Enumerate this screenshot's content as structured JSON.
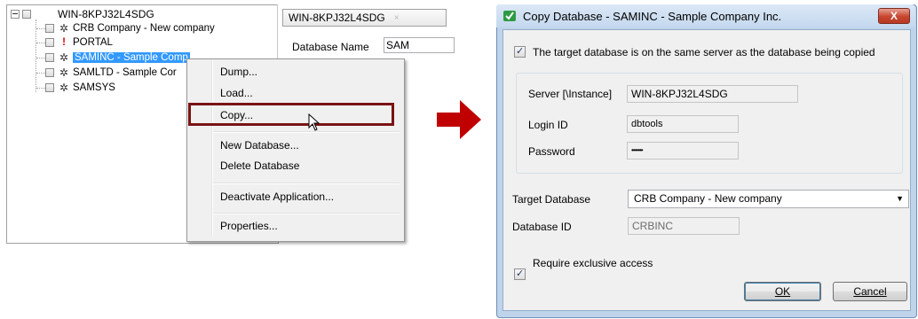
{
  "tree": {
    "root_label": "WIN-8KPJ32L4SDG",
    "items": [
      {
        "label": "CRB Company - New company",
        "icon": "gear"
      },
      {
        "label": "PORTAL",
        "icon": "exclamation"
      },
      {
        "label": "SAMINC - Sample Comp",
        "icon": "gear",
        "selected": true
      },
      {
        "label": "SAMLTD - Sample Cor",
        "icon": "gear"
      },
      {
        "label": "SAMSYS",
        "icon": "gear"
      }
    ]
  },
  "right_pane": {
    "tab_label": "WIN-8KPJ32L4SDG",
    "tab_close": "×",
    "database_name_label": "Database Name",
    "database_name_value": "SAM"
  },
  "context_menu": {
    "items": [
      "Dump...",
      "Load...",
      "Copy...",
      "New Database...",
      "Delete Database",
      "Deactivate Application...",
      "Properties..."
    ]
  },
  "dialog": {
    "title": "Copy Database - SAMINC - Sample Company Inc.",
    "close_glyph": "X",
    "same_server_label": "The target database is on the same server as the database being copied",
    "server_label": "Server [\\Instance]",
    "server_value": "WIN-8KPJ32L4SDG",
    "login_label": "Login ID",
    "login_value": "dbtools",
    "password_label": "Password",
    "password_value": "•••••••",
    "target_db_label": "Target Database",
    "target_db_value": "CRB Company - New company",
    "database_id_label": "Database ID",
    "database_id_value": "CRBINC",
    "exclusive_label": "Require exclusive access",
    "ok_label": "OK",
    "cancel_label": "Cancel"
  },
  "colors": {
    "selection": "#3399ff",
    "highlight_border": "#7a1313",
    "arrow": "#c00000",
    "close_button": "#c7452f"
  }
}
